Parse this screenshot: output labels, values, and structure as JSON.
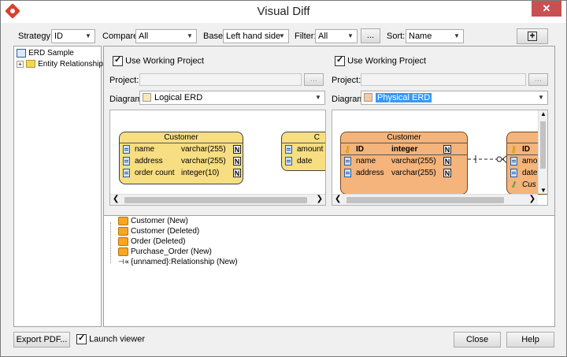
{
  "window": {
    "title": "Visual Diff"
  },
  "toolbar": {
    "strategy_label": "Strategy:",
    "strategy_value": "ID",
    "compare_label": "Compare:",
    "compare_value": "All",
    "base_label": "Base:",
    "base_value": "Left hand side",
    "filter_label": "Filter:",
    "filter_value": "All",
    "filter_more": "...",
    "sort_label": "Sort:",
    "sort_value": "Name",
    "add_icon": "plus-square-icon"
  },
  "tree": {
    "root": "ERD Sample",
    "child": "Entity Relationship"
  },
  "left": {
    "use_working": "Use Working Project",
    "project_label": "Project:",
    "project_btn": "...",
    "diagram_label": "Diagram:",
    "diagram_value": "Logical ERD",
    "entity1": {
      "title": "Customer",
      "rows": [
        {
          "name": "name",
          "type": "varchar(255)",
          "flag": "N"
        },
        {
          "name": "address",
          "type": "varchar(255)",
          "flag": "N"
        },
        {
          "name": "order count",
          "type": "integer(10)",
          "flag": "N"
        }
      ]
    },
    "entity2": {
      "title": "C",
      "rows": [
        {
          "name": "amount"
        },
        {
          "name": "date"
        }
      ]
    }
  },
  "right": {
    "use_working": "Use Working Project",
    "project_label": "Project:",
    "project_btn": "...",
    "diagram_label": "Diagram:",
    "diagram_value": "Physical ERD",
    "entity1": {
      "title": "Customer",
      "rows": [
        {
          "name": "ID",
          "type": "integer",
          "flag": "N"
        },
        {
          "name": "name",
          "type": "varchar(255)",
          "flag": "N"
        },
        {
          "name": "address",
          "type": "varchar(255)",
          "flag": "N"
        }
      ]
    },
    "entity2": {
      "rows": [
        {
          "name": "ID"
        },
        {
          "name": "amo"
        },
        {
          "name": "date"
        },
        {
          "name": "Cus"
        }
      ]
    }
  },
  "changes": [
    {
      "label": "Customer (New)",
      "kind": "table"
    },
    {
      "label": "Customer (Deleted)",
      "kind": "table"
    },
    {
      "label": "Order (Deleted)",
      "kind": "table"
    },
    {
      "label": "Purchase_Order (New)",
      "kind": "table"
    },
    {
      "label": "{unnamed}:Relationship (New)",
      "kind": "relationship"
    }
  ],
  "footer": {
    "export": "Export PDF...",
    "launch_viewer": "Launch viewer",
    "close": "Close",
    "help": "Help"
  },
  "colors": {
    "logical_entity": "#f7de82",
    "physical_entity": "#f4b47c",
    "selection": "#3399ff"
  }
}
